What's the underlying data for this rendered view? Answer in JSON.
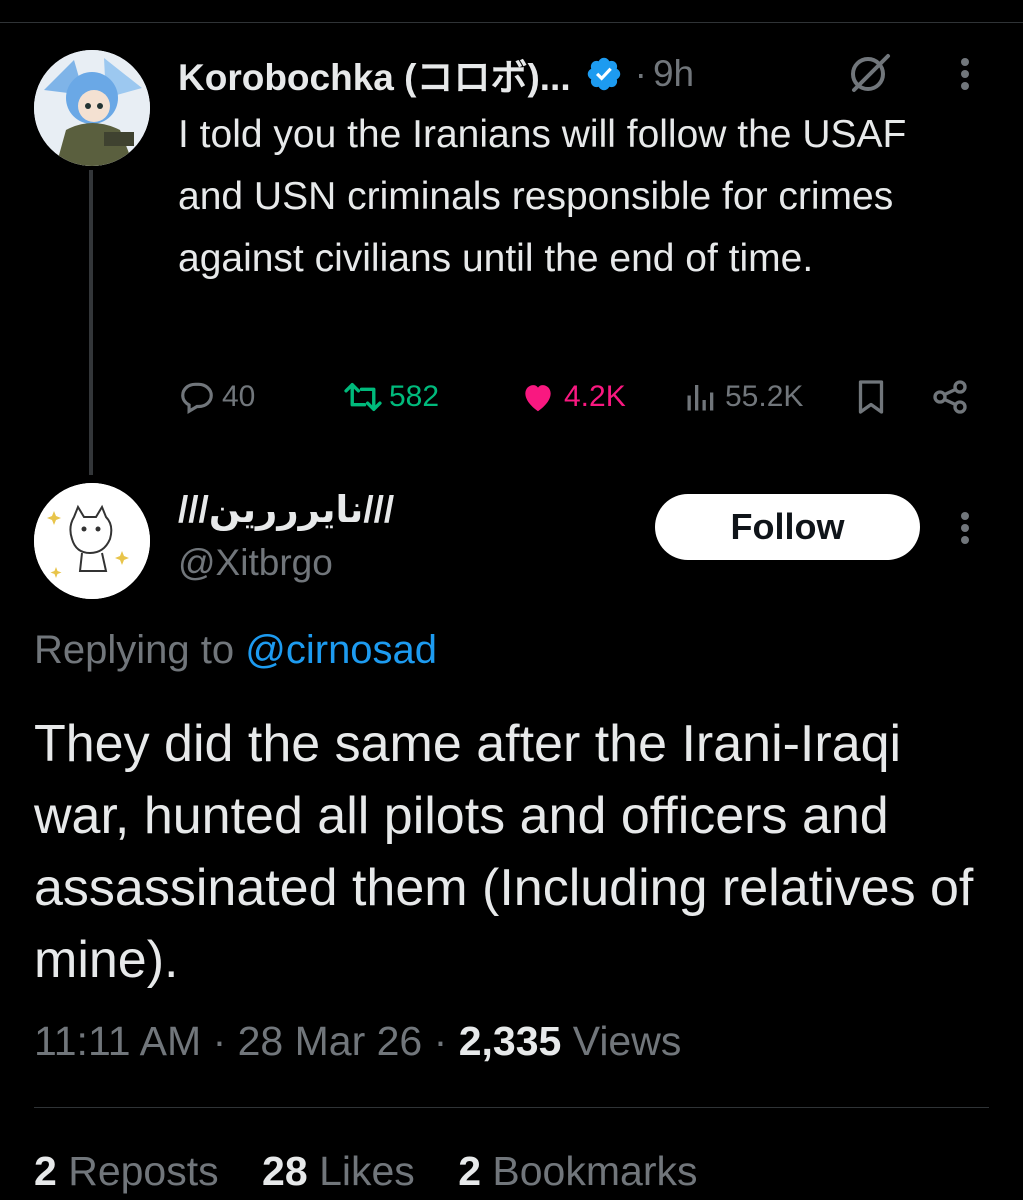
{
  "parent": {
    "author_name": "Korobochka (コロボ)...",
    "separator": "·",
    "time": "9h",
    "text": "I told you the Iranians will follow the USAF and USN criminals responsible for crimes against civilians until the end of time.",
    "replies": "40",
    "reposts": "582",
    "likes": "4.2K",
    "views": "55.2K",
    "icons": [
      "verified-badge-icon",
      "grok-icon",
      "more-icon",
      "reply-icon",
      "repost-icon",
      "like-icon",
      "views-icon",
      "bookmark-icon",
      "share-icon"
    ],
    "colors": {
      "verified": "#1d9bf0",
      "repost": "#00ba7c",
      "like": "#f91880"
    }
  },
  "reply": {
    "author_name": "///نايرررين///",
    "handle": "@Xitbrgo",
    "follow_label": "Follow",
    "replying_prefix": "Replying to",
    "replying_handle": "@cirnosad",
    "text": "They did the same after the Irani-Iraqi war, hunted all pilots and officers and assassinated them (Including relatives of mine).",
    "time": "11:11 AM",
    "date": "28 Mar 26",
    "separator": "·",
    "views_count": "2,335",
    "views_label": "Views",
    "stats": {
      "reposts_count": "2",
      "reposts_label": "Reposts",
      "likes_count": "28",
      "likes_label": "Likes",
      "bookmarks_count": "2",
      "bookmarks_label": "Bookmarks"
    },
    "colors": {
      "mention": "#1d9bf0",
      "follow_bg": "#ffffff"
    }
  }
}
